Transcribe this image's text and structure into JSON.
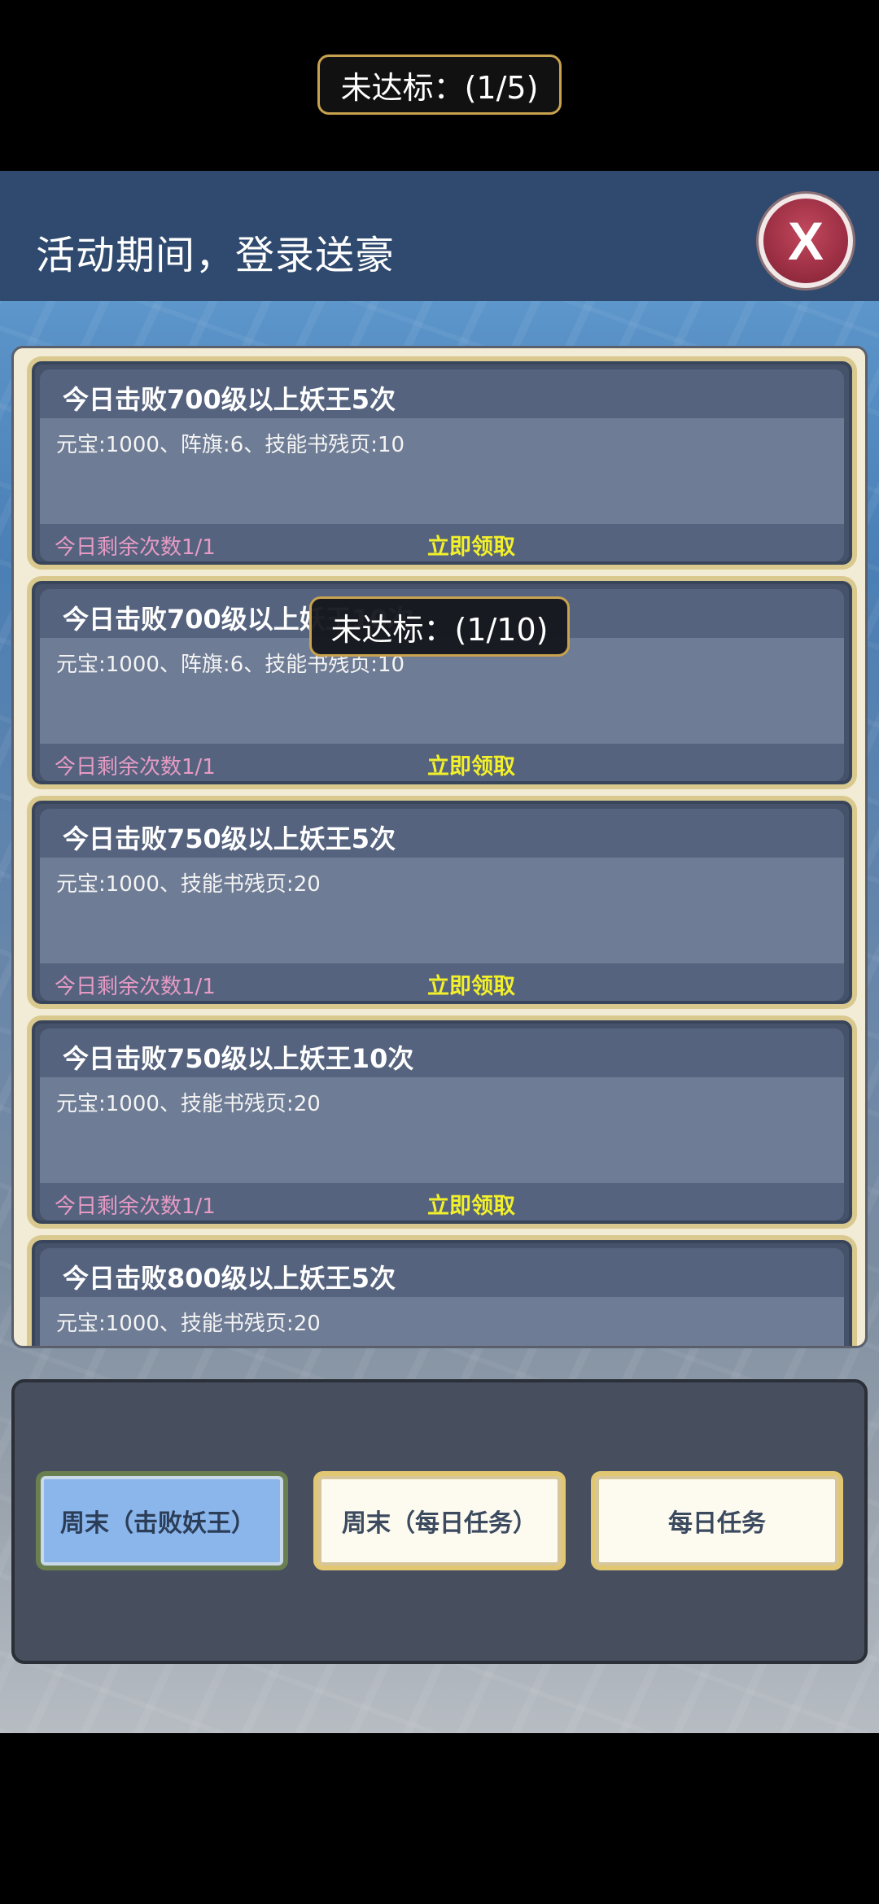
{
  "toast_top": "未达标：(1/5)",
  "toast_mid": "未达标：(1/10)",
  "header": {
    "title": "活动期间，登录送豪",
    "close_label": "X"
  },
  "tasks": [
    {
      "title": "今日击败700级以上妖王5次",
      "reward": "元宝:1000、阵旗:6、技能书残页:10",
      "remain": "今日剩余次数1/1",
      "claim": "立即领取"
    },
    {
      "title": "今日击败700级以上妖王10次",
      "reward": "元宝:1000、阵旗:6、技能书残页:10",
      "remain": "今日剩余次数1/1",
      "claim": "立即领取"
    },
    {
      "title": "今日击败750级以上妖王5次",
      "reward": "元宝:1000、技能书残页:20",
      "remain": "今日剩余次数1/1",
      "claim": "立即领取"
    },
    {
      "title": "今日击败750级以上妖王10次",
      "reward": "元宝:1000、技能书残页:20",
      "remain": "今日剩余次数1/1",
      "claim": "立即领取"
    },
    {
      "title": "今日击败800级以上妖王5次",
      "reward": "元宝:1000、技能书残页:20",
      "remain": "",
      "claim": ""
    }
  ],
  "tabs": [
    {
      "label": "周末（击败妖王）",
      "active": true
    },
    {
      "label": "周末（每日任务）",
      "active": false
    },
    {
      "label": "每日任务",
      "active": false
    }
  ],
  "colors": {
    "header_bg": "#2f4a6e",
    "card_bg": "#46526a",
    "claim": "#f2f02a",
    "remain": "#e79bc4",
    "tab_active": "#8ab6ec",
    "close": "#9c2f44"
  }
}
